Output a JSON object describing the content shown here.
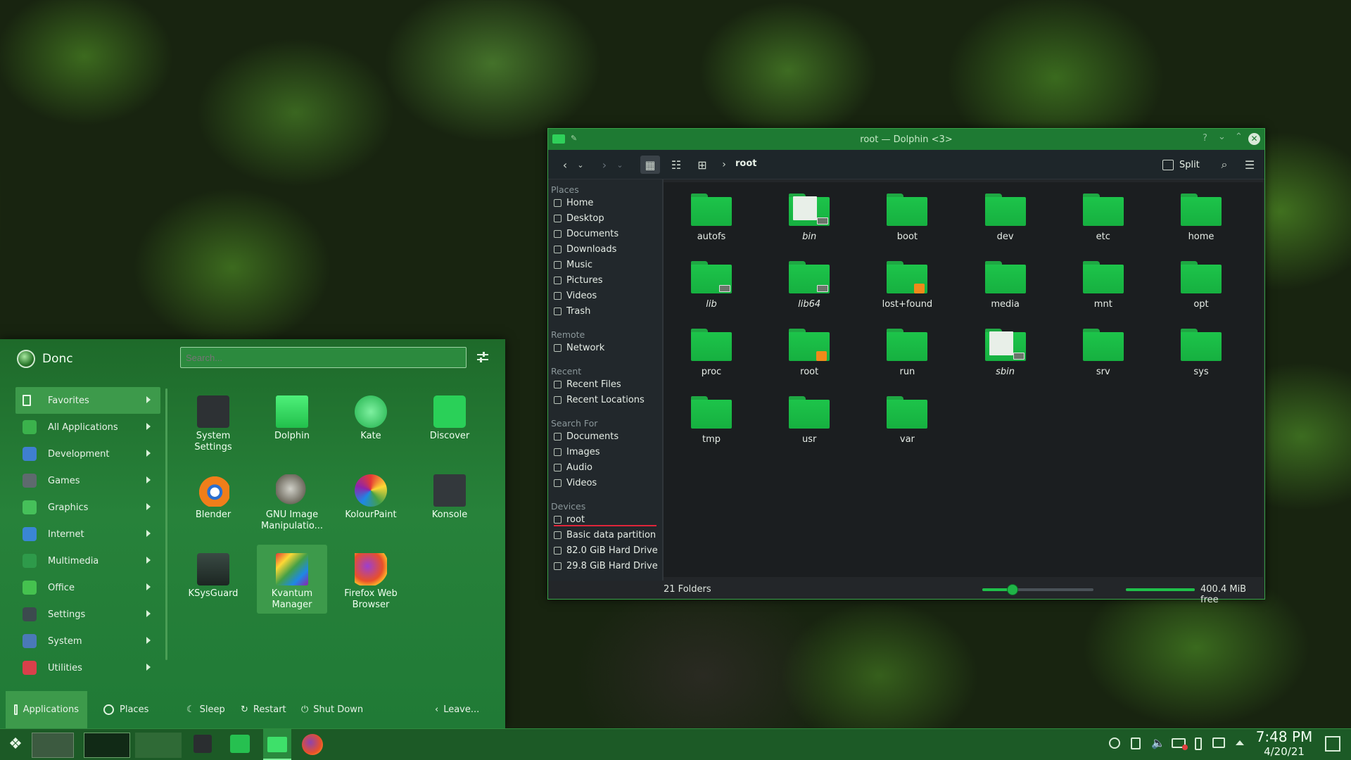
{
  "dolphin": {
    "title": "root — Dolphin <3>",
    "breadcrumb": "root",
    "split_label": "Split",
    "places_sections": [
      {
        "title": "Places",
        "items": [
          "Home",
          "Desktop",
          "Documents",
          "Downloads",
          "Music",
          "Pictures",
          "Videos",
          "Trash"
        ]
      },
      {
        "title": "Remote",
        "items": [
          "Network"
        ]
      },
      {
        "title": "Recent",
        "items": [
          "Recent Files",
          "Recent Locations"
        ]
      },
      {
        "title": "Search For",
        "items": [
          "Documents",
          "Images",
          "Audio",
          "Videos"
        ]
      },
      {
        "title": "Devices",
        "items": [
          "root",
          "Basic data partition",
          "82.0 GiB Hard Drive",
          "29.8 GiB Hard Drive"
        ]
      }
    ],
    "folders": [
      {
        "name": "autofs",
        "type": "plain"
      },
      {
        "name": "bin",
        "type": "link-files",
        "italic": true
      },
      {
        "name": "boot",
        "type": "plain"
      },
      {
        "name": "dev",
        "type": "plain"
      },
      {
        "name": "etc",
        "type": "plain"
      },
      {
        "name": "home",
        "type": "plain"
      },
      {
        "name": "lib",
        "type": "link",
        "italic": true
      },
      {
        "name": "lib64",
        "type": "link",
        "italic": true
      },
      {
        "name": "lost+found",
        "type": "locked"
      },
      {
        "name": "media",
        "type": "plain"
      },
      {
        "name": "mnt",
        "type": "plain"
      },
      {
        "name": "opt",
        "type": "plain"
      },
      {
        "name": "proc",
        "type": "plain"
      },
      {
        "name": "root",
        "type": "locked"
      },
      {
        "name": "run",
        "type": "plain"
      },
      {
        "name": "sbin",
        "type": "link-files",
        "italic": true
      },
      {
        "name": "srv",
        "type": "plain"
      },
      {
        "name": "sys",
        "type": "plain"
      },
      {
        "name": "tmp",
        "type": "plain"
      },
      {
        "name": "usr",
        "type": "plain"
      },
      {
        "name": "var",
        "type": "plain"
      }
    ],
    "status_count": "21 Folders",
    "free_space": "400.4 MiB free",
    "zoom_level": 0.27,
    "disk_used_fraction": 1.0
  },
  "menu": {
    "user": "Donc",
    "search_placeholder": "Search...",
    "categories": [
      {
        "label": "Favorites",
        "icon": "bookmark-icon",
        "color": "#3d9a4b"
      },
      {
        "label": "All Applications",
        "icon": "grid-icon",
        "color": "#3bb24c"
      },
      {
        "label": "Development",
        "icon": "development-icon",
        "color": "#3f7fd0"
      },
      {
        "label": "Games",
        "icon": "gamepad-icon",
        "color": "#5e6a6e"
      },
      {
        "label": "Graphics",
        "icon": "graphics-icon",
        "color": "#46c05a"
      },
      {
        "label": "Internet",
        "icon": "globe-icon",
        "color": "#3a86d4"
      },
      {
        "label": "Multimedia",
        "icon": "monitor-icon",
        "color": "#2e9a4a"
      },
      {
        "label": "Office",
        "icon": "office-icon",
        "color": "#45c24f"
      },
      {
        "label": "Settings",
        "icon": "settings-icon",
        "color": "#3c4a4e"
      },
      {
        "label": "System",
        "icon": "system-icon",
        "color": "#4a79b8"
      },
      {
        "label": "Utilities",
        "icon": "toolbox-icon",
        "color": "#d9404a"
      }
    ],
    "apps": [
      {
        "label": "System Settings",
        "icon": "system-settings-icon"
      },
      {
        "label": "Dolphin",
        "icon": "dolphin-icon"
      },
      {
        "label": "Kate",
        "icon": "kate-icon"
      },
      {
        "label": "Discover",
        "icon": "discover-icon"
      },
      {
        "label": "Blender",
        "icon": "blender-icon"
      },
      {
        "label": "GNU Image Manipulatio...",
        "icon": "gimp-icon"
      },
      {
        "label": "KolourPaint",
        "icon": "kolourpaint-icon"
      },
      {
        "label": "Konsole",
        "icon": "konsole-icon"
      },
      {
        "label": "KSysGuard",
        "icon": "ksysguard-icon"
      },
      {
        "label": "Kvantum Manager",
        "icon": "kvantum-icon"
      },
      {
        "label": "Firefox Web Browser",
        "icon": "firefox-icon"
      }
    ],
    "tabs": {
      "applications": "Applications",
      "places": "Places"
    },
    "power": {
      "sleep": "Sleep",
      "restart": "Restart",
      "shutdown": "Shut Down",
      "leave": "Leave..."
    }
  },
  "taskbar": {
    "time": "7:48 PM",
    "date": "4/20/21"
  }
}
